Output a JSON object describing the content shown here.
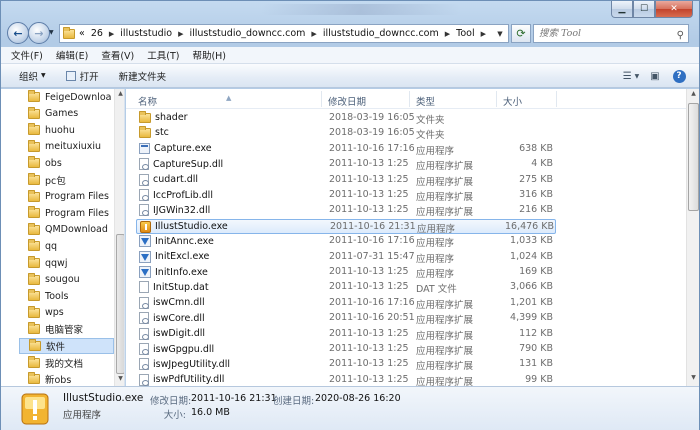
{
  "window": {
    "controls": {
      "minimize": "▁",
      "maximize": "☐",
      "close": "✕"
    }
  },
  "nav": {
    "back_glyph": "←",
    "forward_glyph": "→",
    "address_segments": [
      "«",
      "26",
      "illuststudio",
      "illuststudio_downcc.com",
      "illuststudio_downcc.com",
      "Tool"
    ],
    "search_placeholder": "搜索 Tool"
  },
  "menu": [
    "文件(F)",
    "编辑(E)",
    "查看(V)",
    "工具(T)",
    "帮助(H)"
  ],
  "toolbar": {
    "organize": "组织",
    "open": "打开",
    "new_folder": "新建文件夹"
  },
  "sidebar": {
    "items": [
      "FeigeDownloa",
      "Games",
      "huohu",
      "meituxiuxiu",
      "obs",
      "pc包",
      "Program Files",
      "Program Files",
      "QMDownload",
      "qq",
      "qqwj",
      "sougou",
      "Tools",
      "wps",
      "电脑管家",
      "软件",
      "我的文档",
      "新obs"
    ],
    "selected_index": 15
  },
  "columns": {
    "name": "名称",
    "date": "修改日期",
    "type": "类型",
    "size": "大小"
  },
  "files": [
    {
      "name": "shader",
      "date": "2018-03-19 16:05",
      "type": "文件夹",
      "size": "",
      "icon": "folder-icon"
    },
    {
      "name": "stc",
      "date": "2018-03-19 16:05",
      "type": "文件夹",
      "size": "",
      "icon": "folder-icon"
    },
    {
      "name": "Capture.exe",
      "date": "2011-10-16 17:16",
      "type": "应用程序",
      "size": "638 KB",
      "icon": "exe-icon"
    },
    {
      "name": "CaptureSup.dll",
      "date": "2011-10-13 1:25",
      "type": "应用程序扩展",
      "size": "4 KB",
      "icon": "dll-icon"
    },
    {
      "name": "cudart.dll",
      "date": "2011-10-13 1:25",
      "type": "应用程序扩展",
      "size": "275 KB",
      "icon": "dll-icon"
    },
    {
      "name": "IccProfLib.dll",
      "date": "2011-10-13 1:25",
      "type": "应用程序扩展",
      "size": "316 KB",
      "icon": "dll-icon"
    },
    {
      "name": "IJGWin32.dll",
      "date": "2011-10-13 1:25",
      "type": "应用程序扩展",
      "size": "216 KB",
      "icon": "dll-icon"
    },
    {
      "name": "IllustStudio.exe",
      "date": "2011-10-16 21:31",
      "type": "应用程序",
      "size": "16,476 KB",
      "icon": "illuststudio-icon"
    },
    {
      "name": "InitAnnc.exe",
      "date": "2011-10-16 17:16",
      "type": "应用程序",
      "size": "1,033 KB",
      "icon": "setup-icon"
    },
    {
      "name": "InitExcl.exe",
      "date": "2011-07-31 15:47",
      "type": "应用程序",
      "size": "1,024 KB",
      "icon": "setup-icon"
    },
    {
      "name": "InitInfo.exe",
      "date": "2011-10-13 1:25",
      "type": "应用程序",
      "size": "169 KB",
      "icon": "setup-icon"
    },
    {
      "name": "InitStup.dat",
      "date": "2011-10-13 1:25",
      "type": "DAT 文件",
      "size": "3,066 KB",
      "icon": "dat-icon"
    },
    {
      "name": "iswCmn.dll",
      "date": "2011-10-16 17:16",
      "type": "应用程序扩展",
      "size": "1,201 KB",
      "icon": "dll-icon"
    },
    {
      "name": "iswCore.dll",
      "date": "2011-10-16 20:51",
      "type": "应用程序扩展",
      "size": "4,399 KB",
      "icon": "dll-icon"
    },
    {
      "name": "iswDigit.dll",
      "date": "2011-10-13 1:25",
      "type": "应用程序扩展",
      "size": "112 KB",
      "icon": "dll-icon"
    },
    {
      "name": "iswGpgpu.dll",
      "date": "2011-10-13 1:25",
      "type": "应用程序扩展",
      "size": "790 KB",
      "icon": "dll-icon"
    },
    {
      "name": "iswJpegUtility.dll",
      "date": "2011-10-13 1:25",
      "type": "应用程序扩展",
      "size": "131 KB",
      "icon": "dll-icon"
    },
    {
      "name": "iswPdfUtility.dll",
      "date": "2011-10-13 1:25",
      "type": "应用程序扩展",
      "size": "99 KB",
      "icon": "dll-icon"
    }
  ],
  "selected_file_index": 7,
  "details": {
    "name": "IllustStudio.exe",
    "type": "应用程序",
    "modified_label": "修改日期:",
    "modified_value": "2011-10-16 21:31",
    "created_label": "创建日期:",
    "created_value": "2020-08-26 16:20",
    "size_label": "大小:",
    "size_value": "16.0 MB"
  }
}
